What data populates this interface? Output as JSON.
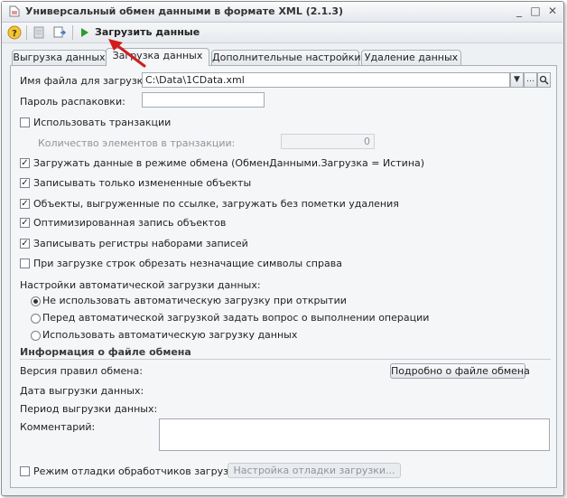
{
  "window": {
    "title": "Универсальный обмен данными в формате XML (2.1.3)",
    "controls": [
      "_",
      "□",
      "✕"
    ]
  },
  "toolbar": {
    "load_label": "Загрузить данные"
  },
  "tabs": [
    {
      "label": "Выгрузка данных",
      "active": false
    },
    {
      "label": "Загрузка данных",
      "active": true
    },
    {
      "label": "Дополнительные настройки",
      "active": false
    },
    {
      "label": "Удаление данных",
      "active": false
    }
  ],
  "form": {
    "file_label": "Имя файла для загрузки:",
    "file_value": "C:\\Data\\1CData.xml",
    "password_label": "Пароль распаковки:",
    "password_value": "",
    "use_transactions": {
      "label": "Использовать транзакции",
      "checked": false
    },
    "tx_count_label": "Количество элементов в транзакции:",
    "tx_count_value": "0",
    "checkboxes": [
      {
        "label": "Загружать данные в режиме обмена (ОбменДанными.Загрузка = Истина)",
        "checked": true
      },
      {
        "label": "Записывать только измененные объекты",
        "checked": true
      },
      {
        "label": "Объекты, выгруженные по ссылке, загружать без пометки удаления",
        "checked": true
      },
      {
        "label": "Оптимизированная запись объектов",
        "checked": true
      },
      {
        "label": "Записывать регистры наборами записей",
        "checked": true
      },
      {
        "label": "При загрузке строк обрезать незначащие символы справа",
        "checked": false
      }
    ],
    "auto_load_title": "Настройки автоматической загрузки данных:",
    "radios": [
      {
        "label": "Не использовать автоматическую загрузку при открытии",
        "selected": true
      },
      {
        "label": "Перед автоматической загрузкой задать вопрос о выполнении операции",
        "selected": false
      },
      {
        "label": "Использовать автоматическую загрузку данных",
        "selected": false
      }
    ],
    "info_section_title": "Информация о файле обмена",
    "rules_version_label": "Версия правил обмена:",
    "details_button": "Подробно о файле обмена",
    "export_date_label": "Дата выгрузки данных:",
    "period_label": "Период выгрузки данных:",
    "comment_label": "Комментарий:",
    "comment_value": "",
    "debug_mode": {
      "label": "Режим отладки обработчиков загрузки",
      "checked": false
    },
    "debug_settings_button": "Настройка отладки загрузки..."
  },
  "colors": {
    "arrow": "#d11d1d",
    "play": "#2e9b2e"
  }
}
